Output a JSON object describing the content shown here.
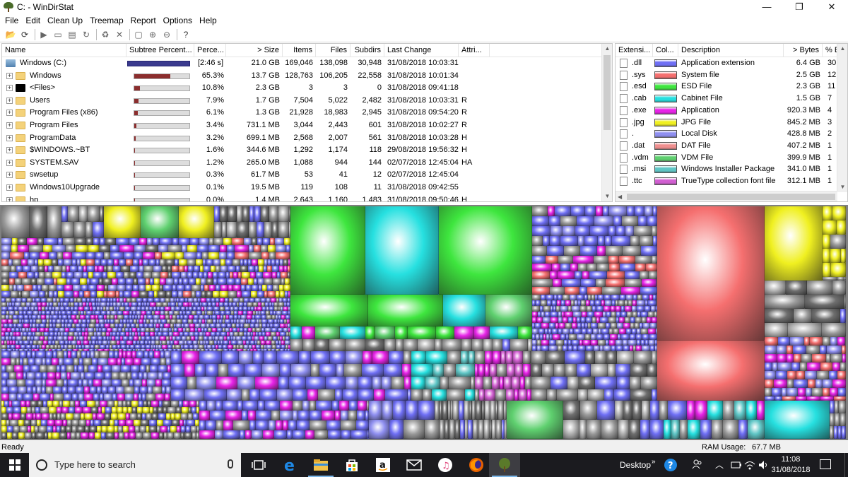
{
  "window": {
    "title": "C: - WinDirStat",
    "controls": [
      "—",
      "❐",
      "✕"
    ]
  },
  "menu": [
    "File",
    "Edit",
    "Clean Up",
    "Treemap",
    "Report",
    "Options",
    "Help"
  ],
  "tree": {
    "columns": [
      "Name",
      "Subtree Percent...",
      "Perce...",
      "> Size",
      "Items",
      "Files",
      "Subdirs",
      "Last Change",
      "Attri..."
    ],
    "rows": [
      {
        "name": "Windows (C:)",
        "kind": "drive",
        "pct": "[2:46 s]",
        "pct_value": 100,
        "size": "21.0 GB",
        "items": "169,046",
        "files": "138,098",
        "subdirs": "30,948",
        "changed": "31/08/2018  10:03:31",
        "attr": ""
      },
      {
        "name": "Windows",
        "kind": "folder",
        "pct": "65.3%",
        "pct_value": 65.3,
        "size": "13.7 GB",
        "items": "128,763",
        "files": "106,205",
        "subdirs": "22,558",
        "changed": "31/08/2018  10:01:34",
        "attr": ""
      },
      {
        "name": "<Files>",
        "kind": "files",
        "pct": "10.8%",
        "pct_value": 10.8,
        "size": "2.3 GB",
        "items": "3",
        "files": "3",
        "subdirs": "0",
        "changed": "31/08/2018  09:41:18",
        "attr": ""
      },
      {
        "name": "Users",
        "kind": "folder",
        "pct": "7.9%",
        "pct_value": 7.9,
        "size": "1.7 GB",
        "items": "7,504",
        "files": "5,022",
        "subdirs": "2,482",
        "changed": "31/08/2018  10:03:31",
        "attr": "R"
      },
      {
        "name": "Program Files (x86)",
        "kind": "folder",
        "pct": "6.1%",
        "pct_value": 6.1,
        "size": "1.3 GB",
        "items": "21,928",
        "files": "18,983",
        "subdirs": "2,945",
        "changed": "31/08/2018  09:54:20",
        "attr": "R"
      },
      {
        "name": "Program Files",
        "kind": "folder",
        "pct": "3.4%",
        "pct_value": 3.4,
        "size": "731.1 MB",
        "items": "3,044",
        "files": "2,443",
        "subdirs": "601",
        "changed": "31/08/2018  10:02:27",
        "attr": "R"
      },
      {
        "name": "ProgramData",
        "kind": "folder",
        "pct": "3.2%",
        "pct_value": 3.2,
        "size": "699.1 MB",
        "items": "2,568",
        "files": "2,007",
        "subdirs": "561",
        "changed": "31/08/2018  10:03:28",
        "attr": "H"
      },
      {
        "name": "$WINDOWS.~BT",
        "kind": "folder",
        "pct": "1.6%",
        "pct_value": 1.6,
        "size": "344.6 MB",
        "items": "1,292",
        "files": "1,174",
        "subdirs": "118",
        "changed": "29/08/2018  19:56:32",
        "attr": "H"
      },
      {
        "name": "SYSTEM.SAV",
        "kind": "folder",
        "pct": "1.2%",
        "pct_value": 1.2,
        "size": "265.0 MB",
        "items": "1,088",
        "files": "944",
        "subdirs": "144",
        "changed": "02/07/2018  12:45:04",
        "attr": "HA"
      },
      {
        "name": "swsetup",
        "kind": "folder",
        "pct": "0.3%",
        "pct_value": 0.3,
        "size": "61.7 MB",
        "items": "53",
        "files": "41",
        "subdirs": "12",
        "changed": "02/07/2018  12:45:04",
        "attr": ""
      },
      {
        "name": "Windows10Upgrade",
        "kind": "folder",
        "pct": "0.1%",
        "pct_value": 0.1,
        "size": "19.5 MB",
        "items": "119",
        "files": "108",
        "subdirs": "11",
        "changed": "31/08/2018  09:42:55",
        "attr": ""
      },
      {
        "name": "hp",
        "kind": "folder",
        "pct": "0.0%",
        "pct_value": 0.0,
        "size": "1.4 MB",
        "items": "2,643",
        "files": "1,160",
        "subdirs": "1,483",
        "changed": "31/08/2018  09:50:46",
        "attr": "H"
      }
    ]
  },
  "extensions": {
    "columns": [
      "Extensi...",
      "Col...",
      "Description",
      "> Bytes",
      "% B"
    ],
    "rows": [
      {
        "ext": ".dll",
        "color": "#6f6ff5",
        "desc": "Application extension",
        "bytes": "6.4 GB",
        "pct": "30"
      },
      {
        "ext": ".sys",
        "color": "#f56f6f",
        "desc": "System file",
        "bytes": "2.5 GB",
        "pct": "12"
      },
      {
        "ext": ".esd",
        "color": "#3ee63e",
        "desc": "ESD File",
        "bytes": "2.3 GB",
        "pct": "11"
      },
      {
        "ext": ".cab",
        "color": "#26e0e0",
        "desc": "Cabinet File",
        "bytes": "1.5 GB",
        "pct": "7"
      },
      {
        "ext": ".exe",
        "color": "#e823e8",
        "desc": "Application",
        "bytes": "920.3 MB",
        "pct": "4"
      },
      {
        "ext": ".jpg",
        "color": "#f0f020",
        "desc": "JPG File",
        "bytes": "845.2 MB",
        "pct": "3"
      },
      {
        "ext": ".",
        "color": "#8f8ff0",
        "desc": "Local Disk",
        "bytes": "428.8 MB",
        "pct": "2"
      },
      {
        "ext": ".dat",
        "color": "#f08f8f",
        "desc": "DAT File",
        "bytes": "407.2 MB",
        "pct": "1"
      },
      {
        "ext": ".vdm",
        "color": "#5fd06f",
        "desc": "VDM File",
        "bytes": "399.9 MB",
        "pct": "1"
      },
      {
        "ext": ".msi",
        "color": "#5fc6c6",
        "desc": "Windows Installer Package",
        "bytes": "341.0 MB",
        "pct": "1"
      },
      {
        "ext": ".ttc",
        "color": "#d25fd2",
        "desc": "TrueType collection font file",
        "bytes": "312.1 MB",
        "pct": "1"
      }
    ]
  },
  "status": {
    "left": "Ready",
    "ram_label": "RAM Usage:",
    "ram_value": "67.7 MB"
  },
  "taskbar": {
    "search_placeholder": "Type here to search",
    "desktop_label": "Desktop",
    "time": "11:08",
    "date": "31/08/2018",
    "apps": [
      "task-view",
      "edge",
      "file-explorer",
      "store",
      "amazon",
      "mail",
      "itunes",
      "firefox",
      "windirstat"
    ]
  },
  "colors": {
    "accent": "#0078d7",
    "bar_fill": "#8b2d2d",
    "root_bar": "#3a3a8e"
  }
}
